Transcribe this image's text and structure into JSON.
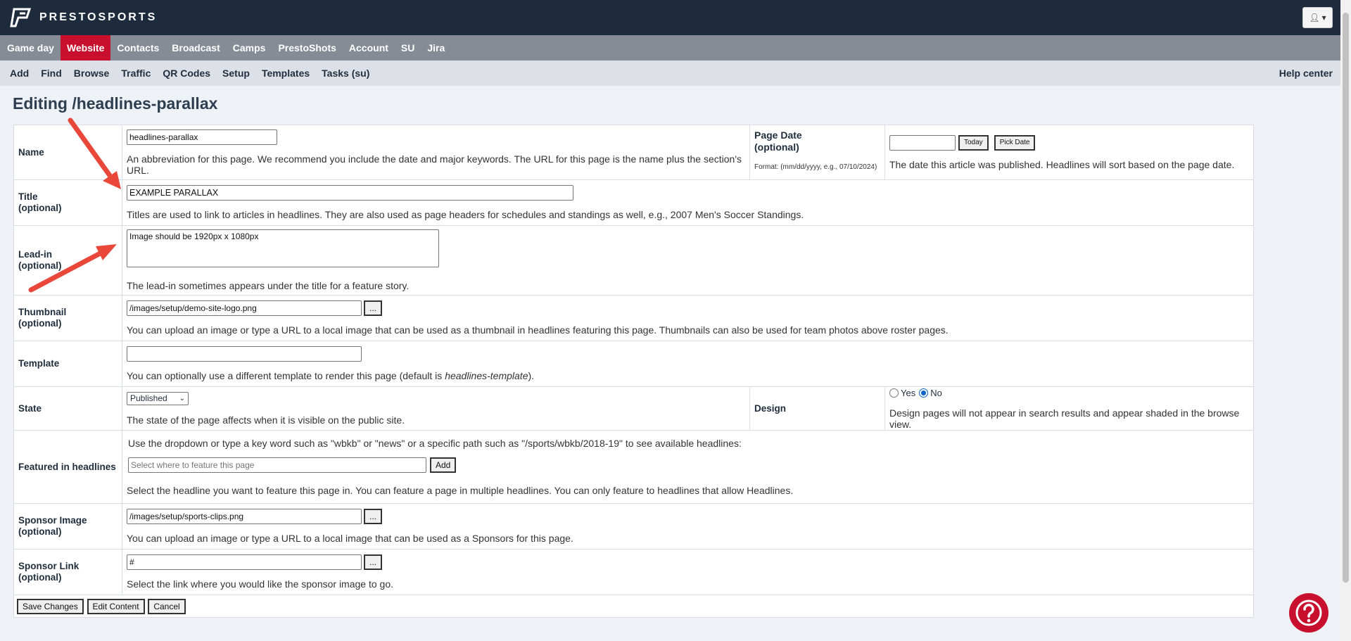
{
  "brand": {
    "name": "PRESTOSPORTS"
  },
  "user_menu": {
    "icon": "user-icon"
  },
  "main_nav": [
    {
      "label": "Game day",
      "active": false
    },
    {
      "label": "Website",
      "active": true
    },
    {
      "label": "Contacts",
      "active": false
    },
    {
      "label": "Broadcast",
      "active": false
    },
    {
      "label": "Camps",
      "active": false
    },
    {
      "label": "PrestoShots",
      "active": false
    },
    {
      "label": "Account",
      "active": false
    },
    {
      "label": "SU",
      "active": false
    },
    {
      "label": "Jira",
      "active": false
    }
  ],
  "sub_nav": [
    "Add",
    "Find",
    "Browse",
    "Traffic",
    "QR Codes",
    "Setup",
    "Templates",
    "Tasks (su)"
  ],
  "help_center": "Help center",
  "page_title": "Editing /headlines-parallax",
  "form": {
    "name": {
      "label": "Name",
      "value": "headlines-parallax",
      "desc": "An abbreviation for this page. We recommend you include the date and major keywords. The URL for this page is the name plus the section's URL."
    },
    "page_date": {
      "label1": "Page Date",
      "label2": "(optional)",
      "format": "Format: (mm/dd/yyyy, e.g., 07/10/2024)",
      "value": "",
      "today": "Today",
      "pick": "Pick Date",
      "desc": "The date this article was published. Headlines will sort based on the page date."
    },
    "title": {
      "label1": "Title",
      "label2": "(optional)",
      "value": "EXAMPLE PARALLAX",
      "desc": "Titles are used to link to articles in headlines. They are also used as page headers for schedules and standings as well, e.g., 2007 Men's Soccer Standings."
    },
    "leadin": {
      "label1": "Lead-in",
      "label2": "(optional)",
      "value": "Image should be 1920px x 1080px",
      "desc": "The lead-in sometimes appears under the title for a feature story."
    },
    "thumbnail": {
      "label1": "Thumbnail",
      "label2": "(optional)",
      "value": "/images/setup/demo-site-logo.png",
      "browse": "...",
      "desc": "You can upload an image or type a URL to a local image that can be used as a thumbnail in headlines featuring this page. Thumbnails can also be used for team photos above roster pages."
    },
    "template": {
      "label": "Template",
      "value": "",
      "desc_pre": "You can optionally use a different template to render this page (default is ",
      "desc_em": "headlines-template",
      "desc_post": ")."
    },
    "state": {
      "label": "State",
      "selected": "Published",
      "desc": "The state of the page affects when it is visible on the public site."
    },
    "design": {
      "label": "Design",
      "yes": "Yes",
      "no": "No",
      "selected": "No",
      "desc": "Design pages will not appear in search results and appear shaded in the browse view."
    },
    "featured": {
      "label": "Featured in headlines",
      "intro": "Use the dropdown or type a key word such as \"wbkb\" or \"news\" or a specific path such as \"/sports/wbkb/2018-19\" to see available headlines:",
      "placeholder": "Select where to feature this page",
      "add": "Add",
      "desc": "Select the headline you want to feature this page in. You can feature a page in multiple headlines. You can only feature to headlines that allow Headlines."
    },
    "sponsor_image": {
      "label1": "Sponsor Image",
      "label2": "(optional)",
      "value": "/images/setup/sports-clips.png",
      "browse": "...",
      "desc": "You can upload an image or type a URL to a local image that can be used as a Sponsors for this page."
    },
    "sponsor_link": {
      "label1": "Sponsor Link",
      "label2": "(optional)",
      "value": "#",
      "browse": "...",
      "desc": "Select the link where you would like the sponsor image to go."
    }
  },
  "actions": {
    "save": "Save Changes",
    "edit": "Edit Content",
    "cancel": "Cancel"
  },
  "help_fab": {
    "icon": "question-icon"
  },
  "colors": {
    "topbar": "#1e2b3c",
    "nav": "#858c96",
    "active": "#c8102e",
    "arrow": "#e8473a"
  }
}
